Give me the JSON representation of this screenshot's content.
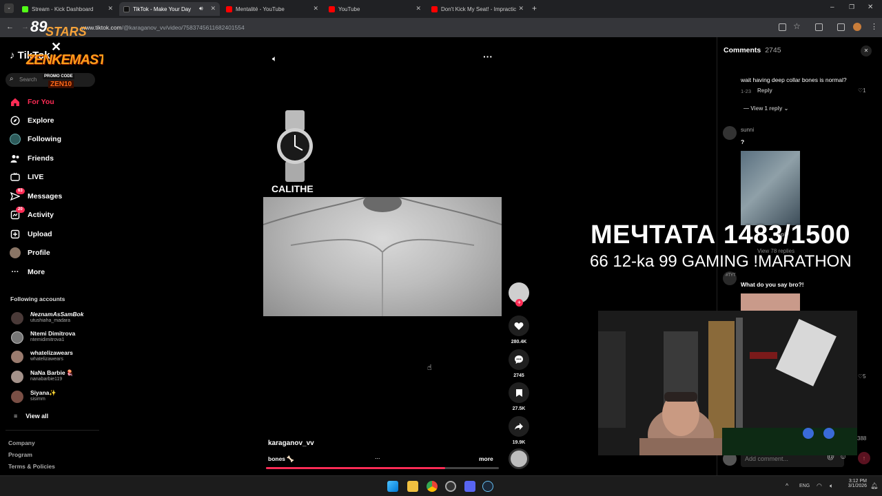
{
  "tabs": [
    {
      "label": "Stream - Kick Dashboard",
      "color": "#53fc18"
    },
    {
      "label": "TikTok - Make Your Day",
      "color": "#111111"
    },
    {
      "label": "Mentalité - YouTube",
      "color": "#ff0000"
    },
    {
      "label": "YouTube",
      "color": "#ff0000"
    },
    {
      "label": "Don't Kick My Seat! - Impractic",
      "color": "#ff0000"
    }
  ],
  "address": {
    "url_host": "www.tiktok.com",
    "url_path": "/@karaganov_vv/video/7583745611682401554"
  },
  "overlay_logo": {
    "stars": "STARS",
    "stars_num": "89",
    "brand": "ZENKEMASTA",
    "promo_label": "PROMO CODE",
    "promo_code": "ZEN10"
  },
  "sidebar": {
    "logo": "TikTok",
    "search_placeholder": "Search",
    "nav": [
      {
        "label": "For You",
        "icon": "home-icon",
        "active": true
      },
      {
        "label": "Explore",
        "icon": "compass-icon"
      },
      {
        "label": "Following",
        "icon": "following-avatar-icon"
      },
      {
        "label": "Friends",
        "icon": "friends-icon"
      },
      {
        "label": "LIVE",
        "icon": "live-icon"
      },
      {
        "label": "Messages",
        "icon": "messages-icon",
        "badge": "63"
      },
      {
        "label": "Activity",
        "icon": "activity-icon",
        "badge": "20"
      },
      {
        "label": "Upload",
        "icon": "upload-icon"
      },
      {
        "label": "Profile",
        "icon": "profile-avatar-icon"
      },
      {
        "label": "More",
        "icon": "more-icon"
      }
    ],
    "following_title": "Following accounts",
    "accounts": [
      {
        "name": "NeznamAsSamBok",
        "user": "utushiaha_madara"
      },
      {
        "name": "Ntemi Dimitrova",
        "user": "ntemidimitrova1"
      },
      {
        "name": "whatelizawears",
        "user": "whatelizawears"
      },
      {
        "name": "NaNa Barbie 🪼",
        "user": "nanabarbie119"
      },
      {
        "name": "Siyana✨",
        "user": "sisimm"
      }
    ],
    "view_all": "View all",
    "footer": [
      "Company",
      "Program",
      "Terms & Policies"
    ]
  },
  "video": {
    "brand_text": "CALITHE",
    "author": "karaganov_vv",
    "caption": "bones 🦴",
    "caption_dots": "...",
    "more": "more",
    "progress": 0.77,
    "actions": {
      "likes": "280.4K",
      "comments": "2745",
      "saves": "27.5K",
      "shares": "19.9K"
    }
  },
  "comments": {
    "title": "Comments",
    "count": "2745",
    "items": [
      {
        "text": "wait having deep collar bones is normal?",
        "date": "1-23",
        "reply": "Reply",
        "likes": "1",
        "view_replies": "View 1 reply"
      },
      {
        "user": "sunni",
        "text": "?",
        "reply": "Reply",
        "view_replies": "View 78 replies"
      },
      {
        "user": "#TYT",
        "text": "What do you say bro?!",
        "likes": "5"
      }
    ],
    "count_bottom": "388",
    "add_placeholder": "Add comment..."
  },
  "stream_overlay": {
    "title": "МЕЧТАТА 1483/1500",
    "subtitle": "66 12-ka 99 GAMING !MARATHON"
  },
  "taskbar": {
    "lang": "ENG",
    "time": "3:12 PM",
    "date": "3/1/2026"
  }
}
